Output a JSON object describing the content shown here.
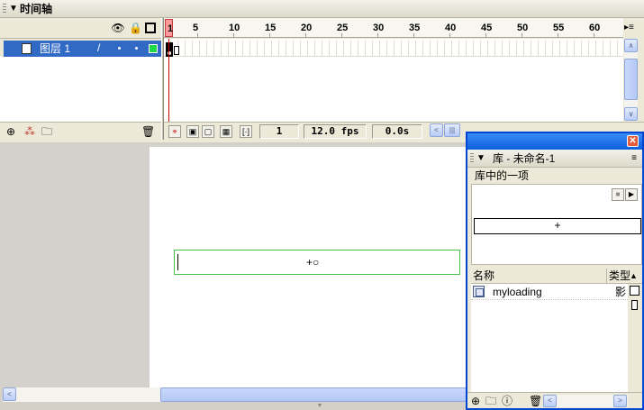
{
  "timeline": {
    "title": "时间轴",
    "collapse_glyph": "▼",
    "layer_header": {
      "eye_glyph": "👁",
      "lock_glyph": "🔒"
    },
    "layer": {
      "name": "图层 1",
      "pencil_glyph": "/",
      "color": "#24d84c"
    },
    "ruler": {
      "playhead_label": "1",
      "labels": [
        "5",
        "10",
        "15",
        "20",
        "25",
        "30",
        "35",
        "40",
        "45",
        "50",
        "55",
        "60"
      ],
      "menu_glyph": "▸≡"
    },
    "footer_icons": {
      "insert_layer": "⊕",
      "motion_guide": "⁂",
      "folder": "🗀",
      "trash": "🗑"
    },
    "controls": {
      "current_frame": "1",
      "frame_rate": "12.0 fps",
      "elapsed_time": "0.0s"
    }
  },
  "stage": {
    "registration_glyph": "+○"
  },
  "library": {
    "close_glyph": "✕",
    "title": "库 - 未命名-1",
    "collapse_glyph": "▼",
    "menu_glyph": "≡",
    "item_count": "库中的一项",
    "preview_glyph": "+",
    "columns": {
      "name": "名称",
      "type": "类型",
      "sort_glyph": "▲"
    },
    "items": [
      {
        "name": "myloading",
        "type": "影"
      }
    ]
  },
  "scroll": {
    "left_glyph": "<",
    "right_glyph": ">",
    "up_glyph": "∧",
    "down_glyph": "∨"
  }
}
